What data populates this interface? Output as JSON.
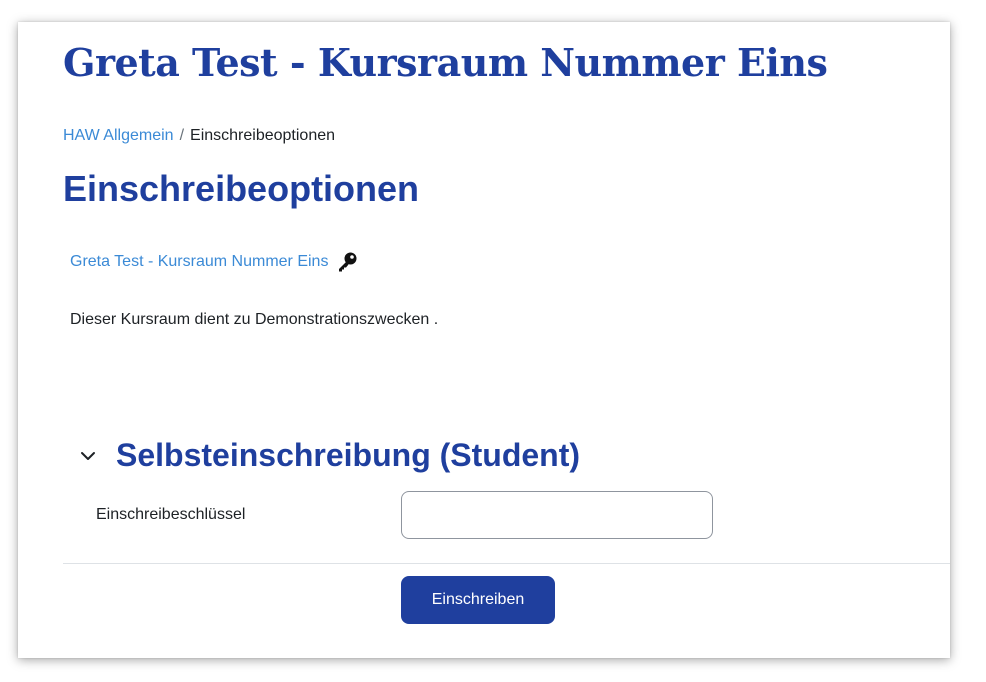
{
  "course": {
    "title": "Greta Test - Kursraum Nummer Eins"
  },
  "breadcrumb": {
    "items": [
      {
        "label": "HAW Allgemein",
        "link": true
      },
      {
        "label": "Einschreibeoptionen",
        "link": false
      }
    ],
    "separator": "/"
  },
  "page": {
    "heading": "Einschreibeoptionen"
  },
  "course_info": {
    "link_label": "Greta Test - Kursraum Nummer Eins",
    "icon": "key-icon",
    "summary": "Dieser Kursraum dient zu Demonstrationszwecken ."
  },
  "enrolment": {
    "section_title": "Selbsteinschreibung (Student)",
    "section_icon": "chevron-down-icon",
    "key_label": "Einschreibeschlüssel",
    "key_value": "",
    "submit_label": "Einschreiben"
  },
  "colors": {
    "primary": "#1f3f9e",
    "link": "#3b8ad6",
    "text": "#1d2125"
  }
}
